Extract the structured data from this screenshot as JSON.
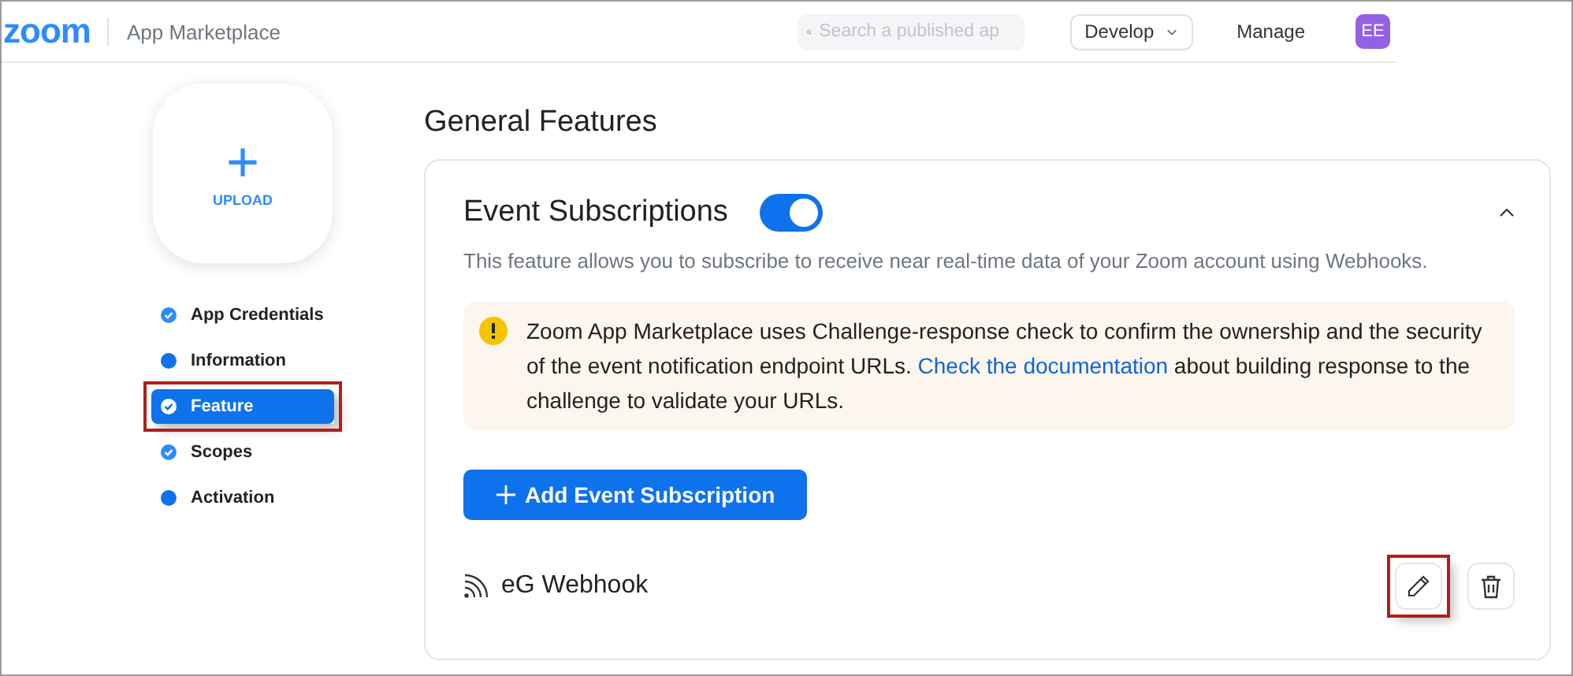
{
  "header": {
    "logo": "zoom",
    "title": "App Marketplace",
    "search": {
      "placeholder": "Search a published ap"
    },
    "develop_menu": "Develop",
    "manage_link": "Manage",
    "avatar": "EE"
  },
  "sidebar": {
    "upload": {
      "icon": "+",
      "label": "UPLOAD"
    },
    "steps": [
      {
        "label": "App Credentials",
        "completed": true,
        "selected": false,
        "highlighted": false
      },
      {
        "label": "Information",
        "completed": false,
        "selected": false,
        "highlighted": false
      },
      {
        "label": "Feature",
        "completed": true,
        "selected": true,
        "highlighted": true
      },
      {
        "label": "Scopes",
        "completed": true,
        "selected": false,
        "highlighted": false
      },
      {
        "label": "Activation",
        "completed": false,
        "selected": false,
        "highlighted": false
      }
    ]
  },
  "page_title": "General Features",
  "section": {
    "title": "Event Subscriptions",
    "on": true,
    "expanded": true,
    "description": "This feature allows you to subscribe to receive near real-time data of your Zoom account using Webhooks.",
    "notice": {
      "before": "Zoom App Marketplace uses Challenge-response check to confirm the ownership and the security of the event notification endpoint URLs.",
      "link": "Check the documentation",
      "after": "about building response to the challenge to validate your URLs."
    },
    "add_button": "Add Event Subscription",
    "subscriptions": [
      {
        "name": "eG Webhook",
        "edit_highlighted": true
      }
    ]
  }
}
